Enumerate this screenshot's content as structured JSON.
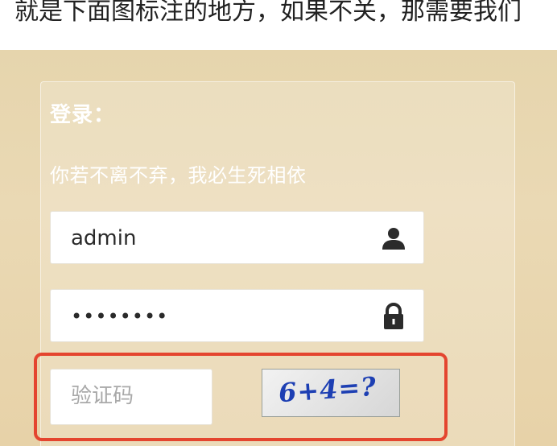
{
  "article": {
    "text": "就是下面图标注的地方，如果不关，那需要我们"
  },
  "login": {
    "title": "登录：",
    "subtitle": "你若不离不弃，我必生死相依",
    "username": {
      "value": "admin",
      "icon": "user-icon"
    },
    "password": {
      "value": "••••••••",
      "icon": "lock-icon"
    },
    "captcha": {
      "placeholder": "验证码",
      "image_text": "6+4=?"
    }
  },
  "colors": {
    "highlight": "#e4452f",
    "background": "#e8d6ae",
    "captcha_text": "#1d3fb3"
  }
}
